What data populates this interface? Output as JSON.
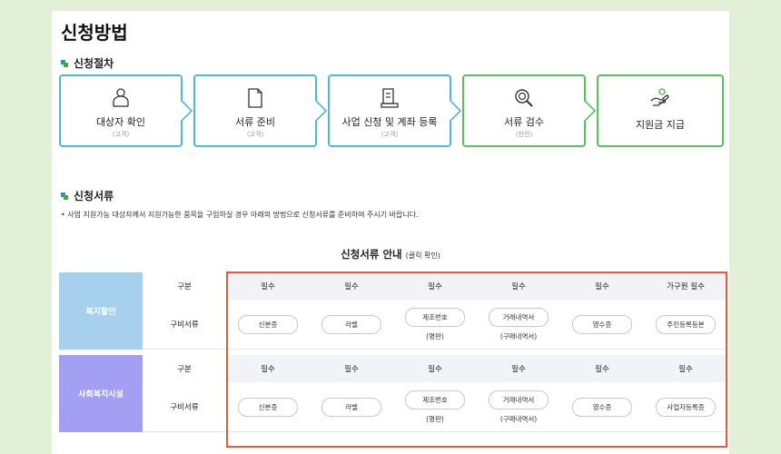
{
  "page_title": "신청방법",
  "procedure": {
    "title": "신청절차",
    "steps": [
      {
        "label": "대상자 확인",
        "sub": "(고객)",
        "icon": "person-icon"
      },
      {
        "label": "서류 준비",
        "sub": "(고객)",
        "icon": "document-icon"
      },
      {
        "label": "사업 신청 및 계좌 등록",
        "sub": "(고객)",
        "icon": "form-icon"
      },
      {
        "label": "서류 검수",
        "sub": "(한전)",
        "icon": "magnifier-icon"
      },
      {
        "label": "지원금 지급",
        "sub": "",
        "icon": "hand-coin-icon"
      }
    ]
  },
  "documents": {
    "title": "신청서류",
    "description": "• 사업 지원가능 대상자께서 지원가능한 품목을 구입하실 경우 아래의 방법으로 신청서류를 준비하여 주시기 바랍니다.",
    "guide_title": "신청서류 안내",
    "guide_note": "(클릭 확인)",
    "groups": [
      {
        "category": "복지할인",
        "header_label": "구분",
        "row_label": "구비서류",
        "requirements": [
          "필수",
          "필수",
          "필수",
          "필수",
          "필수",
          "가구원 필수"
        ],
        "docs": [
          {
            "name": "신분증",
            "note": ""
          },
          {
            "name": "라벨",
            "note": ""
          },
          {
            "name": "제조번호",
            "note": "(명판)"
          },
          {
            "name": "거래내역서",
            "note": "(구매내역서)"
          },
          {
            "name": "영수증",
            "note": ""
          },
          {
            "name": "주민등록등본",
            "note": ""
          }
        ]
      },
      {
        "category": "사회복지시설",
        "header_label": "구분",
        "row_label": "구비서류",
        "requirements": [
          "필수",
          "필수",
          "필수",
          "필수",
          "필수",
          "필수"
        ],
        "docs": [
          {
            "name": "신분증",
            "note": ""
          },
          {
            "name": "라벨",
            "note": ""
          },
          {
            "name": "제조번호",
            "note": "(명판)"
          },
          {
            "name": "거래내역서",
            "note": "(구매내역서)"
          },
          {
            "name": "영수증",
            "note": ""
          },
          {
            "name": "사업자등록증",
            "note": ""
          }
        ]
      }
    ]
  },
  "colors": {
    "step_border_blue": "#4fb8d6",
    "step_border_green": "#57c15c",
    "category_welfare": "#a7d0ef",
    "category_facility": "#a39ff2",
    "highlight_box": "#f0553a"
  }
}
